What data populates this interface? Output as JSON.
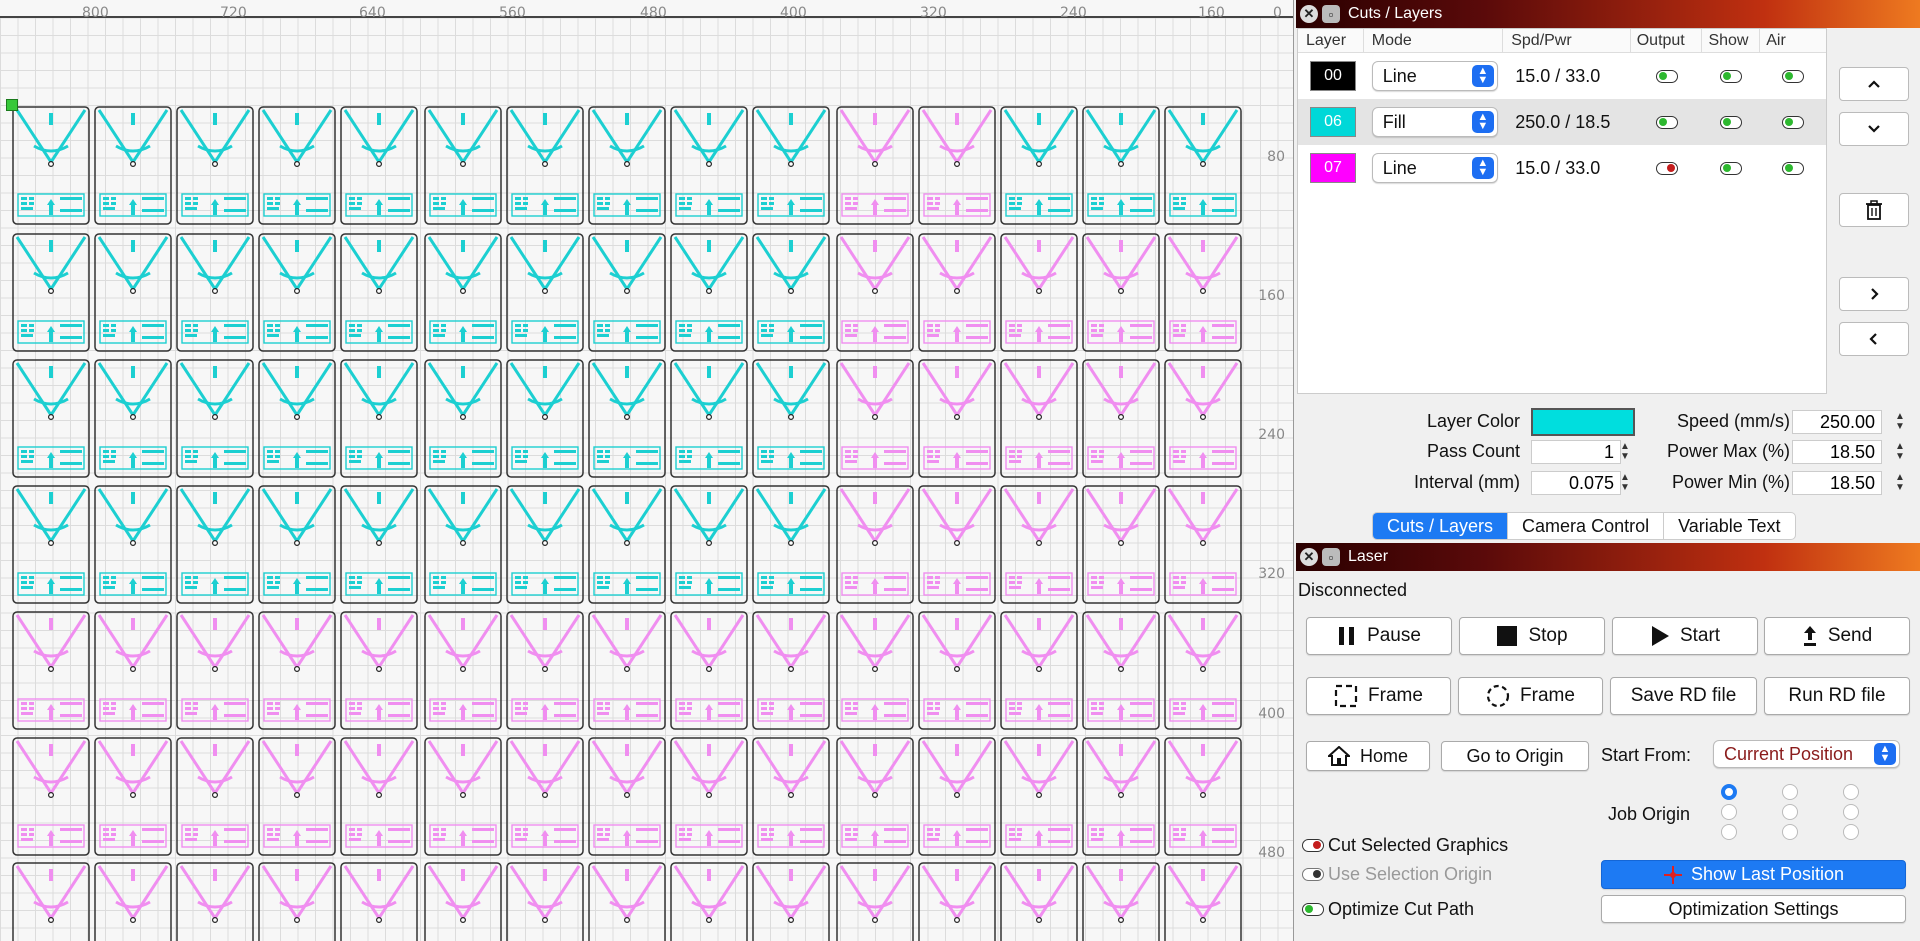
{
  "canvas": {
    "ruler_x": [
      "800",
      "720",
      "640",
      "560",
      "480",
      "400",
      "320",
      "240",
      "160",
      "0"
    ],
    "ruler_y": [
      "80",
      "160",
      "240",
      "320",
      "400",
      "480"
    ],
    "colors": {
      "cyan": "#1ccfd1",
      "pink": "#f08ef0"
    }
  },
  "cuts_panel": {
    "title": "Cuts / Layers",
    "columns": [
      "Layer",
      "Mode",
      "Spd/Pwr",
      "Output",
      "Show",
      "Air"
    ],
    "rows": [
      {
        "layer": "00",
        "color": "#000000",
        "mode": "Line",
        "spd_pwr": "15.0 / 33.0",
        "output": true,
        "show": true,
        "air": true
      },
      {
        "layer": "06",
        "color": "#00d8d8",
        "mode": "Fill",
        "spd_pwr": "250.0 / 18.5",
        "output": true,
        "show": true,
        "air": true
      },
      {
        "layer": "07",
        "color": "#ff00ff",
        "mode": "Line",
        "spd_pwr": "15.0 / 33.0",
        "output": false,
        "show": true,
        "air": true
      }
    ],
    "side_icons": [
      "chevron-up-icon",
      "chevron-down-icon",
      "trash-icon",
      "chevron-right-icon",
      "chevron-left-icon"
    ],
    "props": {
      "layer_color_label": "Layer Color",
      "layer_color": "#00dede",
      "pass_count_label": "Pass Count",
      "pass_count": "1",
      "interval_label": "Interval (mm)",
      "interval": "0.075",
      "speed_label": "Speed (mm/s)",
      "speed": "250.00",
      "power_max_label": "Power Max (%)",
      "power_max": "18.50",
      "power_min_label": "Power Min (%)",
      "power_min": "18.50"
    },
    "tabs": [
      "Cuts / Layers",
      "Camera Control",
      "Variable Text"
    ]
  },
  "laser_panel": {
    "title": "Laser",
    "status": "Disconnected",
    "pause": "Pause",
    "stop": "Stop",
    "start": "Start",
    "send": "Send",
    "frame1": "Frame",
    "frame2": "Frame",
    "save_rd": "Save RD file",
    "run_rd": "Run RD file",
    "home": "Home",
    "go_origin": "Go to Origin",
    "start_from_label": "Start From:",
    "start_from": "Current Position",
    "job_origin_label": "Job Origin",
    "cut_selected": "Cut Selected Graphics",
    "use_selection_origin": "Use Selection Origin",
    "optimize_cut_path": "Optimize Cut Path",
    "show_last_position": "Show Last Position",
    "optimization_settings": "Optimization Settings"
  }
}
